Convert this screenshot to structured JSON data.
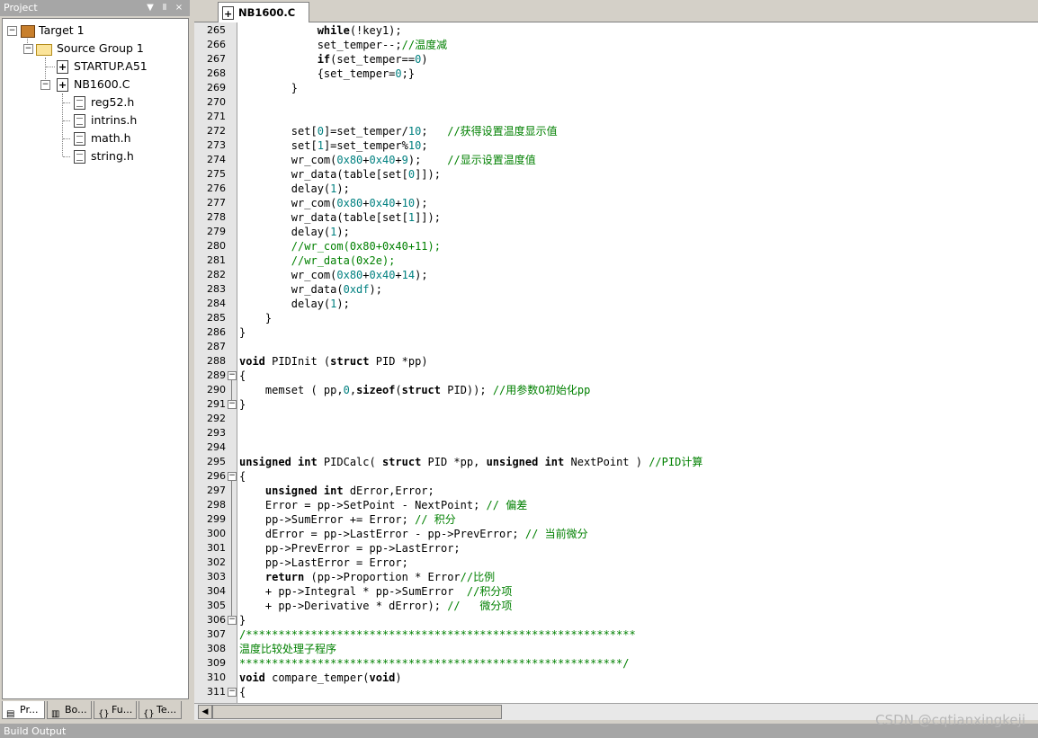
{
  "project_panel": {
    "title": "Project",
    "controls": [
      "▼",
      "Ⅱ",
      "×"
    ],
    "tree": {
      "target": "Target 1",
      "group": "Source Group 1",
      "files": [
        "STARTUP.A51",
        "NB1600.C"
      ],
      "includes": [
        "reg52.h",
        "intrins.h",
        "math.h",
        "string.h"
      ]
    },
    "tabs": [
      "Pr...",
      "Bo...",
      "Fu...",
      "Te..."
    ]
  },
  "editor": {
    "tab_label": "NB1600.C",
    "lines": [
      {
        "n": "265",
        "html": "            <span class=\"kw\">while</span>(!key1);"
      },
      {
        "n": "266",
        "html": "            set_temper--;<span class=\"cm\">//</span><span class=\"cmzh\">温度减</span>"
      },
      {
        "n": "267",
        "html": "            <span class=\"kw\">if</span>(set_temper==<span class=\"num\">0</span>)"
      },
      {
        "n": "268",
        "html": "            {set_temper=<span class=\"num\">0</span>;}"
      },
      {
        "n": "269",
        "html": "        }"
      },
      {
        "n": "270",
        "html": ""
      },
      {
        "n": "271",
        "html": ""
      },
      {
        "n": "272",
        "html": "        set[<span class=\"num\">0</span>]=set_temper/<span class=\"num\">10</span>;   <span class=\"cm\">//</span><span class=\"cmzh\">获得设置温度显示值</span>"
      },
      {
        "n": "273",
        "html": "        set[<span class=\"num\">1</span>]=set_temper%<span class=\"num\">10</span>;"
      },
      {
        "n": "274",
        "html": "        wr_com(<span class=\"num\">0x80</span>+<span class=\"num\">0x40</span>+<span class=\"num\">9</span>);    <span class=\"cm\">//</span><span class=\"cmzh\">显示设置温度值</span>"
      },
      {
        "n": "275",
        "html": "        wr_data(table[set[<span class=\"num\">0</span>]]);"
      },
      {
        "n": "276",
        "html": "        delay(<span class=\"num\">1</span>);"
      },
      {
        "n": "277",
        "html": "        wr_com(<span class=\"num\">0x80</span>+<span class=\"num\">0x40</span>+<span class=\"num\">10</span>);"
      },
      {
        "n": "278",
        "html": "        wr_data(table[set[<span class=\"num\">1</span>]]);"
      },
      {
        "n": "279",
        "html": "        delay(<span class=\"num\">1</span>);"
      },
      {
        "n": "280",
        "html": "        <span class=\"cm\">//wr_com(0x80+0x40+11);</span>"
      },
      {
        "n": "281",
        "html": "        <span class=\"cm\">//wr_data(0x2e);</span>"
      },
      {
        "n": "282",
        "html": "        wr_com(<span class=\"num\">0x80</span>+<span class=\"num\">0x40</span>+<span class=\"num\">14</span>);"
      },
      {
        "n": "283",
        "html": "        wr_data(<span class=\"num\">0xdf</span>);"
      },
      {
        "n": "284",
        "html": "        delay(<span class=\"num\">1</span>);"
      },
      {
        "n": "285",
        "html": "    }"
      },
      {
        "n": "286",
        "html": "}"
      },
      {
        "n": "287",
        "html": ""
      },
      {
        "n": "288",
        "html": "<span class=\"kw\">void</span> PIDInit (<span class=\"kw\">struct</span> PID *pp)"
      },
      {
        "n": "289",
        "html": "{"
      },
      {
        "n": "290",
        "html": "    memset ( pp,<span class=\"num\">0</span>,<span class=\"kw\">sizeof</span>(<span class=\"kw\">struct</span> PID)); <span class=\"cm\">//</span><span class=\"cmzh\">用参数0初始化</span><span class=\"cm\">pp</span>"
      },
      {
        "n": "291",
        "html": "}"
      },
      {
        "n": "292",
        "html": ""
      },
      {
        "n": "293",
        "html": ""
      },
      {
        "n": "294",
        "html": ""
      },
      {
        "n": "295",
        "html": "<span class=\"kw\">unsigned int</span> PIDCalc( <span class=\"kw\">struct</span> PID *pp, <span class=\"kw\">unsigned int</span> NextPoint ) <span class=\"cm\">//PID</span><span class=\"cmzh\">计算</span>"
      },
      {
        "n": "296",
        "html": "{"
      },
      {
        "n": "297",
        "html": "    <span class=\"kw\">unsigned int</span> dError,Error;"
      },
      {
        "n": "298",
        "html": "    Error = pp->SetPoint - NextPoint; <span class=\"cm\">// </span><span class=\"cmzh\">偏差</span>"
      },
      {
        "n": "299",
        "html": "    pp->SumError += Error; <span class=\"cm\">// </span><span class=\"cmzh\">积分</span>"
      },
      {
        "n": "300",
        "html": "    dError = pp->LastError - pp->PrevError; <span class=\"cm\">// </span><span class=\"cmzh\">当前微分</span>"
      },
      {
        "n": "301",
        "html": "    pp->PrevError = pp->LastError;"
      },
      {
        "n": "302",
        "html": "    pp->LastError = Error;"
      },
      {
        "n": "303",
        "html": "    <span class=\"kw\">return</span> (pp->Proportion * Error<span class=\"cm\">//</span><span class=\"cmzh\">比例</span>"
      },
      {
        "n": "304",
        "html": "    + pp->Integral * pp->SumError  <span class=\"cm\">//</span><span class=\"cmzh\">积分项</span>"
      },
      {
        "n": "305",
        "html": "    + pp->Derivative * dError); <span class=\"cm\">//   </span><span class=\"cmzh\">微分项</span>"
      },
      {
        "n": "306",
        "html": "}"
      },
      {
        "n": "307",
        "html": "<span class=\"cm\">/************************************************************</span>"
      },
      {
        "n": "308",
        "html": "<span class=\"cmzh\">温度比较处理子程序</span>"
      },
      {
        "n": "309",
        "html": "<span class=\"cm\">***********************************************************/</span>"
      },
      {
        "n": "310",
        "html": "<span class=\"kw\">void</span> compare_temper(<span class=\"kw\">void</span>)"
      },
      {
        "n": "311",
        "html": "{"
      }
    ]
  },
  "build_output": {
    "title": "Build Output"
  },
  "watermark": "CSDN @cqtianxingkeji"
}
